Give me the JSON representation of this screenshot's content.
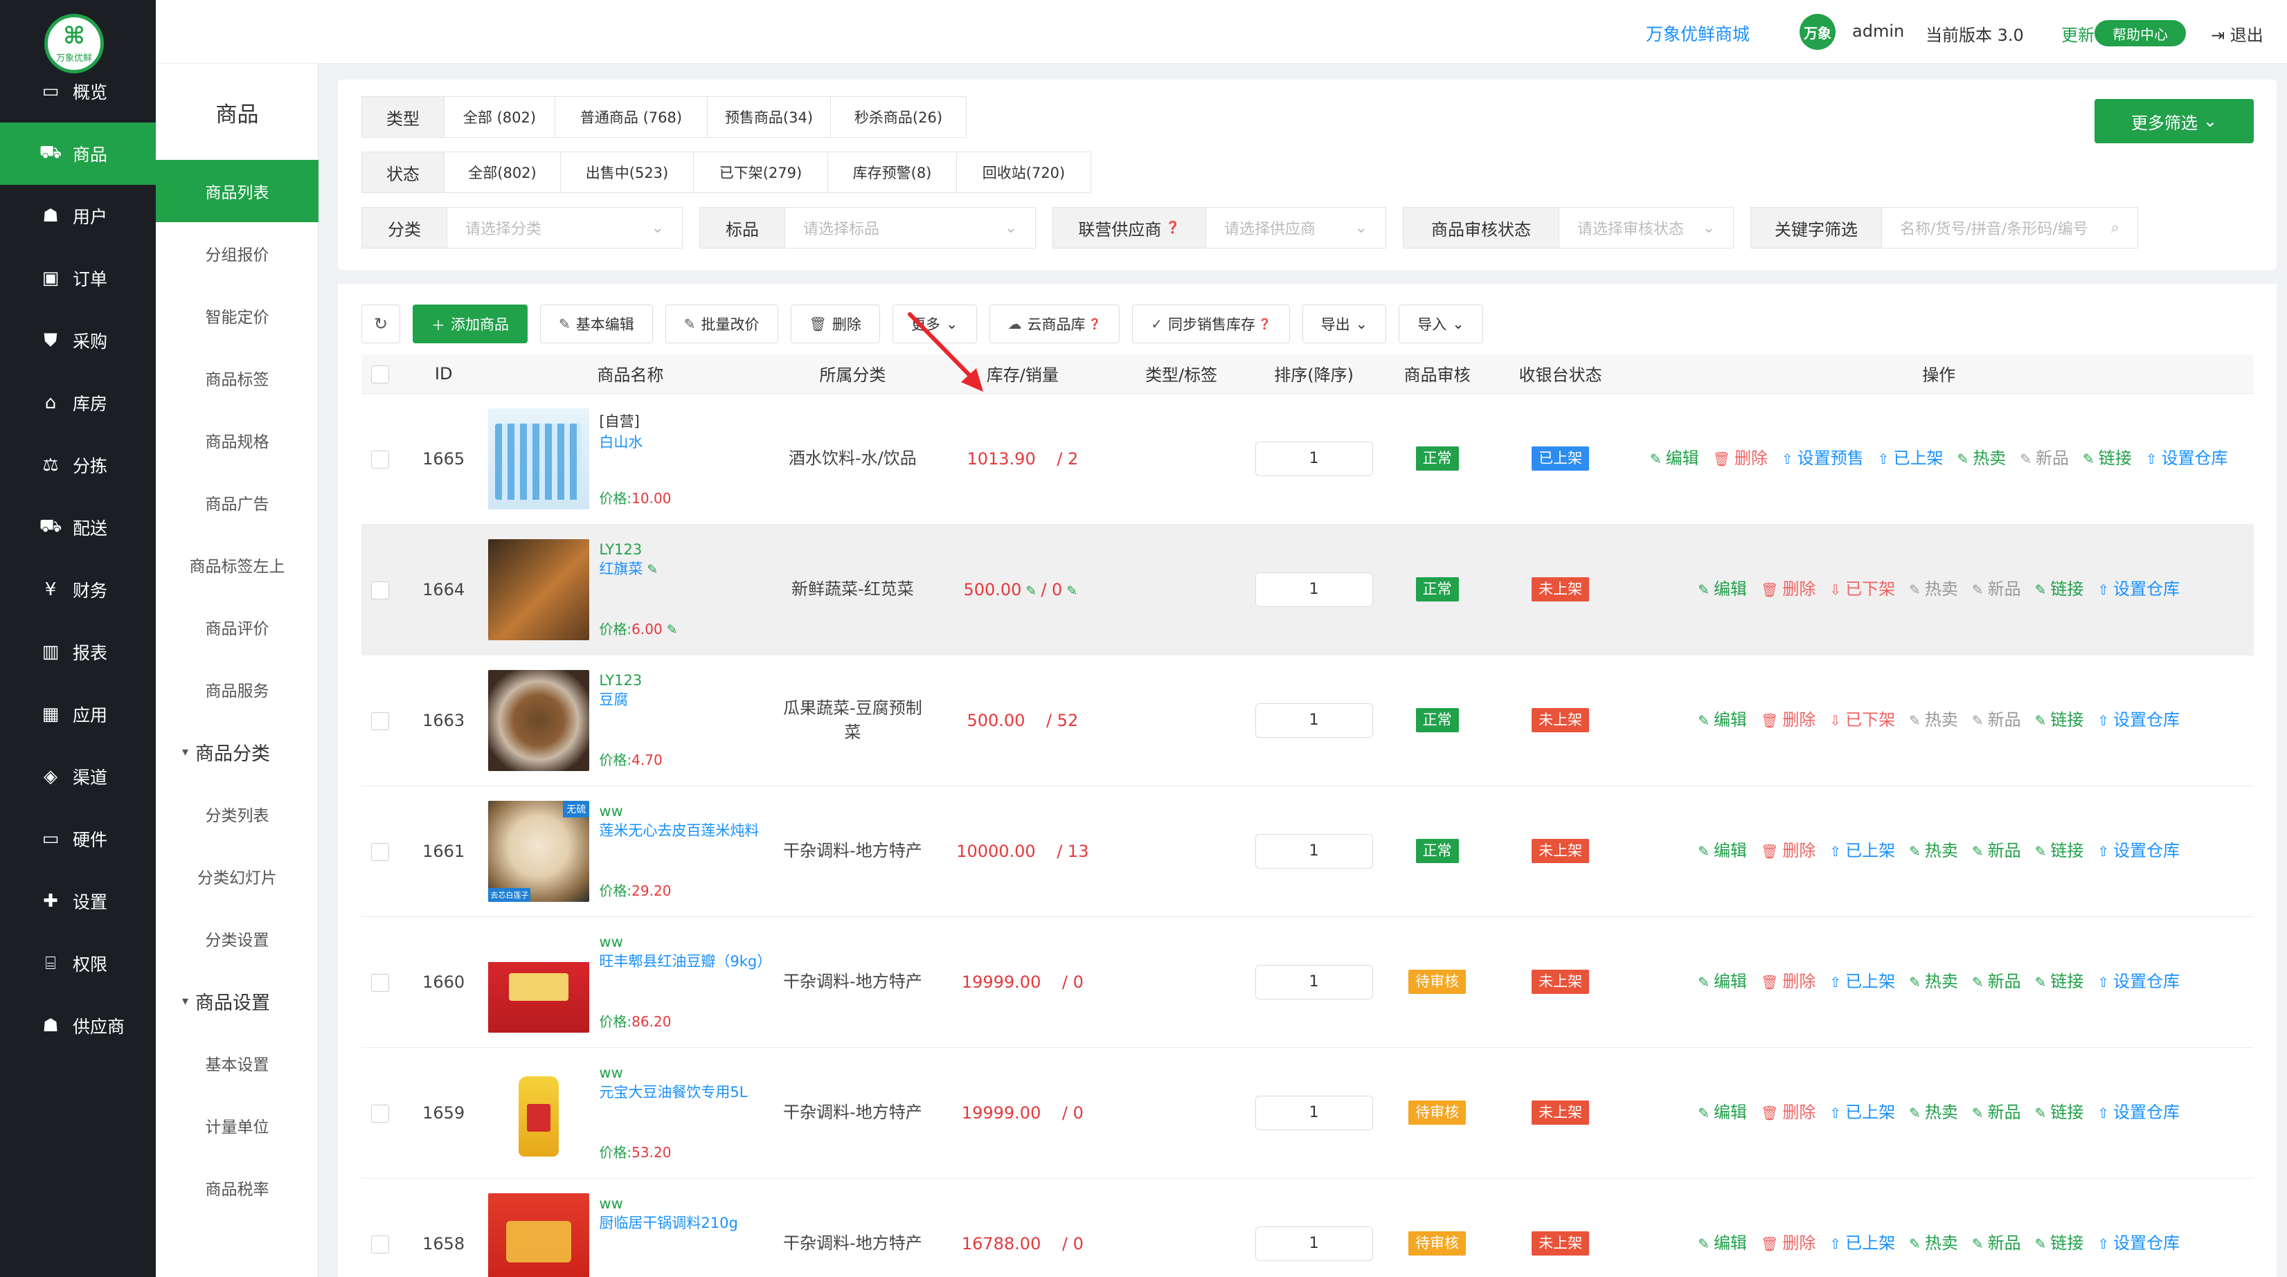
{
  "nav": {
    "logo_text": "万象优鲜",
    "items": [
      {
        "icon": "monitor-icon",
        "glyph": "▭",
        "label": "概览"
      },
      {
        "icon": "cart-icon",
        "glyph": "⛟",
        "label": "商品"
      },
      {
        "icon": "users-icon",
        "glyph": "☗",
        "label": "用户"
      },
      {
        "icon": "order-icon",
        "glyph": "▣",
        "label": "订单"
      },
      {
        "icon": "purchase-icon",
        "glyph": "⛊",
        "label": "采购"
      },
      {
        "icon": "warehouse-icon",
        "glyph": "⌂",
        "label": "库房"
      },
      {
        "icon": "scale-icon",
        "glyph": "⚖",
        "label": "分拣"
      },
      {
        "icon": "truck-icon",
        "glyph": "⛟",
        "label": "配送"
      },
      {
        "icon": "yen-icon",
        "glyph": "¥",
        "label": "财务"
      },
      {
        "icon": "bar-chart-icon",
        "glyph": "▥",
        "label": "报表"
      },
      {
        "icon": "app-icon",
        "glyph": "▦",
        "label": "应用"
      },
      {
        "icon": "cube-icon",
        "glyph": "◈",
        "label": "渠道"
      },
      {
        "icon": "hardware-icon",
        "glyph": "▭",
        "label": "硬件"
      },
      {
        "icon": "puzzle-icon",
        "glyph": "✚",
        "label": "设置"
      },
      {
        "icon": "bank-icon",
        "glyph": "⌸",
        "label": "权限"
      },
      {
        "icon": "supplier-icon",
        "glyph": "☗",
        "label": "供应商"
      }
    ]
  },
  "sub": {
    "title": "商品",
    "items": [
      {
        "type": "item",
        "label": "商品列表",
        "active": true
      },
      {
        "type": "item",
        "label": "分组报价"
      },
      {
        "type": "item",
        "label": "智能定价"
      },
      {
        "type": "item",
        "label": "商品标签"
      },
      {
        "type": "item",
        "label": "商品规格"
      },
      {
        "type": "item",
        "label": "商品广告"
      },
      {
        "type": "item",
        "label": "商品标签左上"
      },
      {
        "type": "item",
        "label": "商品评价"
      },
      {
        "type": "item",
        "label": "商品服务"
      },
      {
        "type": "group",
        "label": "商品分类"
      },
      {
        "type": "item",
        "label": "分类列表"
      },
      {
        "type": "item",
        "label": "分类幻灯片"
      },
      {
        "type": "item",
        "label": "分类设置"
      },
      {
        "type": "group",
        "label": "商品设置"
      },
      {
        "type": "item",
        "label": "基本设置"
      },
      {
        "type": "item",
        "label": "计量单位"
      },
      {
        "type": "item",
        "label": "商品税率"
      }
    ]
  },
  "header": {
    "shop_name": "万象优鲜商城",
    "avatar_text": "万象",
    "username": "admin",
    "version": "当前版本  3.0",
    "update": "更新",
    "help": "帮助中心",
    "logout": "退出"
  },
  "filter": {
    "type_label": "类型",
    "type_tabs": [
      "全部 (802)",
      "普通商品 (768)",
      "预售商品(34)",
      "秒杀商品(26)"
    ],
    "status_label": "状态",
    "status_tabs": [
      "全部(802)",
      "出售中(523)",
      "已下架(279)",
      "库存预警(8)",
      "回收站(720)"
    ],
    "category_label": "分类",
    "category_placeholder": "请选择分类",
    "tag_label": "标品",
    "tag_placeholder": "请选择标品",
    "supplier_label": "联营供应商",
    "supplier_placeholder": "请选择供应商",
    "audit_label": "商品审核状态",
    "audit_placeholder": "请选择审核状态",
    "keyword_label": "关键字筛选",
    "keyword_placeholder": "名称/货号/拼音/条形码/编号",
    "more": "更多筛选"
  },
  "toolbar": {
    "add": "添加商品",
    "basic_edit": "基本编辑",
    "batch_price": "批量改价",
    "delete": "删除",
    "more": "更多",
    "cloud": "云商品库",
    "sync_stock": "同步销售库存",
    "export": "导出",
    "import": "导入"
  },
  "table": {
    "headers": [
      "ID",
      "商品名称",
      "所属分类",
      "库存/销量",
      "类型/标签",
      "排序(降序)",
      "商品审核",
      "收银台状态",
      "操作"
    ],
    "price_prefix": "价格:",
    "rows": [
      {
        "id": "1665",
        "brand": "[自营]",
        "brand_self": true,
        "name": "白山水",
        "price": "10.00",
        "category": "酒水饮料-水/饮品",
        "stock": "1013.90",
        "sales": "/ 2",
        "sort": "1",
        "audit": "正常",
        "audit_color": "green",
        "pos": "已上架",
        "pos_color": "blue",
        "img": "img-water",
        "editable": false,
        "highlight": false,
        "ops": [
          [
            "edit",
            "编辑"
          ],
          [
            "del",
            "删除"
          ],
          [
            "blue",
            "设置预售"
          ],
          [
            "blue",
            "已上架"
          ],
          [
            "edit",
            "热卖"
          ],
          [
            "grey",
            "新品"
          ],
          [
            "edit",
            "链接"
          ],
          [
            "blue",
            "设置仓库"
          ]
        ]
      },
      {
        "id": "1664",
        "brand": "LY123",
        "name": "红旗菜",
        "price": "6.00",
        "category": "新鲜蔬菜-红苋菜",
        "stock": "500.00",
        "sales": "/ 0",
        "sort": "1",
        "audit": "正常",
        "audit_color": "green",
        "pos": "未上架",
        "pos_color": "red",
        "img": "img-skewer",
        "editable": true,
        "highlight": true,
        "ops": [
          [
            "edit",
            "编辑"
          ],
          [
            "del",
            "删除"
          ],
          [
            "orange",
            "已下架"
          ],
          [
            "grey",
            "热卖"
          ],
          [
            "grey",
            "新品"
          ],
          [
            "edit",
            "链接"
          ],
          [
            "blue",
            "设置仓库"
          ]
        ]
      },
      {
        "id": "1663",
        "brand": "LY123",
        "name": "豆腐",
        "price": "4.70",
        "category": "瓜果蔬菜-豆腐预制菜",
        "stock": "500.00",
        "sales": "/ 52",
        "sort": "1",
        "audit": "正常",
        "audit_color": "green",
        "pos": "未上架",
        "pos_color": "red",
        "img": "img-tofu",
        "editable": false,
        "highlight": false,
        "ops": [
          [
            "edit",
            "编辑"
          ],
          [
            "del",
            "删除"
          ],
          [
            "orange",
            "已下架"
          ],
          [
            "grey",
            "热卖"
          ],
          [
            "grey",
            "新品"
          ],
          [
            "edit",
            "链接"
          ],
          [
            "blue",
            "设置仓库"
          ]
        ]
      },
      {
        "id": "1661",
        "brand": "ww",
        "name": "莲米无心去皮百莲米炖料",
        "price": "29.20",
        "category": "干杂调料-地方特产",
        "stock": "10000.00",
        "sales": "/ 13",
        "sort": "1",
        "audit": "正常",
        "audit_color": "green",
        "pos": "未上架",
        "pos_color": "red",
        "img": "img-lotus",
        "img_tag1": "无硫",
        "img_tag2": "去芯白莲子",
        "editable": false,
        "highlight": false,
        "ops": [
          [
            "edit",
            "编辑"
          ],
          [
            "del",
            "删除"
          ],
          [
            "blue",
            "已上架"
          ],
          [
            "edit",
            "热卖"
          ],
          [
            "edit",
            "新品"
          ],
          [
            "edit",
            "链接"
          ],
          [
            "blue",
            "设置仓库"
          ]
        ]
      },
      {
        "id": "1660",
        "brand": "ww",
        "name": "旺丰郫县红油豆瓣（9kg）",
        "price": "86.20",
        "category": "干杂调料-地方特产",
        "stock": "19999.00",
        "sales": "/ 0",
        "sort": "1",
        "audit": "待审核",
        "audit_color": "orange",
        "pos": "未上架",
        "pos_color": "red",
        "img": "img-box",
        "editable": false,
        "highlight": false,
        "ops": [
          [
            "edit",
            "编辑"
          ],
          [
            "del",
            "删除"
          ],
          [
            "blue",
            "已上架"
          ],
          [
            "edit",
            "热卖"
          ],
          [
            "edit",
            "新品"
          ],
          [
            "edit",
            "链接"
          ],
          [
            "blue",
            "设置仓库"
          ]
        ]
      },
      {
        "id": "1659",
        "brand": "ww",
        "name": "元宝大豆油餐饮专用5L",
        "price": "53.20",
        "category": "干杂调料-地方特产",
        "stock": "19999.00",
        "sales": "/ 0",
        "sort": "1",
        "audit": "待审核",
        "audit_color": "orange",
        "pos": "未上架",
        "pos_color": "red",
        "img": "img-oil",
        "editable": false,
        "highlight": false,
        "ops": [
          [
            "edit",
            "编辑"
          ],
          [
            "del",
            "删除"
          ],
          [
            "blue",
            "已上架"
          ],
          [
            "edit",
            "热卖"
          ],
          [
            "edit",
            "新品"
          ],
          [
            "edit",
            "链接"
          ],
          [
            "blue",
            "设置仓库"
          ]
        ]
      },
      {
        "id": "1658",
        "brand": "ww",
        "name": "厨临居干锅调料210g",
        "price": "",
        "category": "干杂调料-地方特产",
        "stock": "16788.00",
        "sales": "/ 0",
        "sort": "1",
        "audit": "待审核",
        "audit_color": "orange",
        "pos": "未上架",
        "pos_color": "red",
        "img": "img-sauce",
        "editable": false,
        "highlight": false,
        "ops": [
          [
            "edit",
            "编辑"
          ],
          [
            "del",
            "删除"
          ],
          [
            "blue",
            "已上架"
          ],
          [
            "edit",
            "热卖"
          ],
          [
            "edit",
            "新品"
          ],
          [
            "edit",
            "链接"
          ],
          [
            "blue",
            "设置仓库"
          ]
        ]
      }
    ]
  }
}
